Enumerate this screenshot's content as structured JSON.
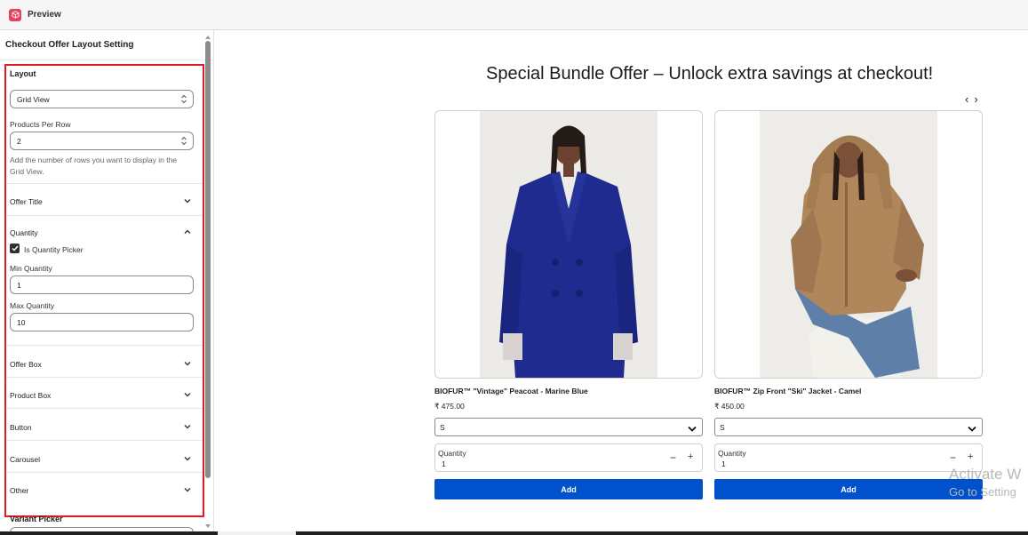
{
  "window": {
    "title": "Preview"
  },
  "sidebar": {
    "header": "Checkout Offer Layout Setting",
    "layout": {
      "section_label": "Layout",
      "view_select": "Grid View",
      "per_row_label": "Products Per Row",
      "per_row_value": "2",
      "help_text": "Add the number of rows you want to display in the Grid View."
    },
    "accordion": {
      "offer_title": "Offer Title",
      "quantity": "Quantity",
      "offer_box": "Offer Box",
      "product_box": "Product Box",
      "button": "Button",
      "carousel": "Carousel",
      "other": "Other"
    },
    "quantity": {
      "picker_label": "Is Quantity Picker",
      "picker_checked": true,
      "min_label": "Min Quantity",
      "min_value": "1",
      "max_label": "Max Quantity",
      "max_value": "10"
    },
    "variant_picker": "Variant Picker"
  },
  "preview": {
    "title": "Special Bundle Offer – Unlock extra savings at checkout!",
    "prev_arrow": "‹",
    "next_arrow": "›",
    "products": [
      {
        "name": "BIOFUR™ \"Vintage\" Peacoat - Marine Blue",
        "price": "₹ 475.00",
        "variant": "S",
        "qty_label": "Quantity",
        "qty_value": "1",
        "minus": "−",
        "plus": "+",
        "add_label": "Add"
      },
      {
        "name": "BIOFUR™ Zip Front \"Ski\" Jacket - Camel",
        "price": "₹ 450.00",
        "variant": "S",
        "qty_label": "Quantity",
        "qty_value": "1",
        "minus": "−",
        "plus": "+",
        "add_label": "Add"
      }
    ]
  },
  "watermark": {
    "line1": "Activate W",
    "line2": "Go to Setting"
  },
  "colors": {
    "accent": "#0052cc",
    "highlight": "#e01b24",
    "app_icon": "#e5415c"
  }
}
